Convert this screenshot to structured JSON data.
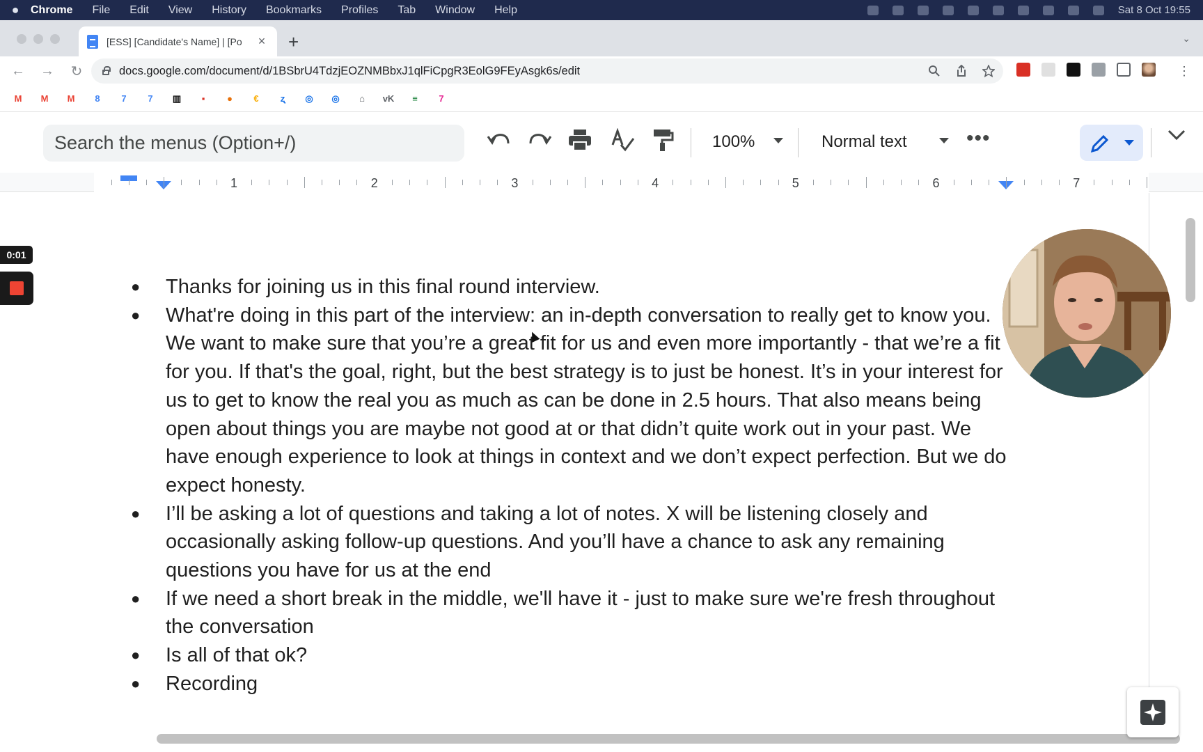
{
  "macos_menubar": {
    "app_name": "Chrome",
    "menus": [
      "File",
      "Edit",
      "View",
      "History",
      "Bookmarks",
      "Profiles",
      "Tab",
      "Window",
      "Help"
    ],
    "clock": "Sat 8 Oct  19:55"
  },
  "browser": {
    "tab": {
      "title": "[ESS] [Candidate's Name] | [Po",
      "close_glyph": "×"
    },
    "new_tab_glyph": "+",
    "tab_menu_glyph": "⌄",
    "address_bar": {
      "url": "docs.google.com/document/d/1BSbrU4TdzjEOZNMBbxJ1qlFiCpgR3EolG9FEyAsgk6s/edit"
    },
    "nav": {
      "back": "←",
      "forward": "→",
      "reload": "↻"
    }
  },
  "bookmarks": [
    {
      "icon": "gmail-icon",
      "glyph": "M",
      "color": "#ea4335"
    },
    {
      "icon": "gmail-icon",
      "glyph": "M",
      "color": "#ea4335"
    },
    {
      "icon": "gmail-icon",
      "glyph": "M",
      "color": "#ea4335"
    },
    {
      "icon": "calendar-icon",
      "glyph": "8",
      "color": "#4285f4"
    },
    {
      "icon": "calendar-icon",
      "glyph": "7",
      "color": "#4285f4"
    },
    {
      "icon": "calendar-icon",
      "glyph": "7",
      "color": "#4285f4"
    },
    {
      "icon": "trello-icon",
      "glyph": "▥",
      "color": "#111111"
    },
    {
      "icon": "app-icon",
      "glyph": "▪",
      "color": "#d93025"
    },
    {
      "icon": "app-icon",
      "glyph": "●",
      "color": "#e8710a"
    },
    {
      "icon": "euro-icon",
      "glyph": "€",
      "color": "#f9ab00"
    },
    {
      "icon": "app-icon",
      "glyph": "ʐ",
      "color": "#1a73e8"
    },
    {
      "icon": "chat-icon",
      "glyph": "◎",
      "color": "#1a73e8"
    },
    {
      "icon": "chat-icon",
      "glyph": "◎",
      "color": "#1a73e8"
    },
    {
      "icon": "app-icon",
      "glyph": "⌂",
      "color": "#5f6368"
    },
    {
      "icon": "vk-icon",
      "glyph": "vK",
      "color": "#5f6368"
    },
    {
      "icon": "list-icon",
      "glyph": "≡",
      "color": "#188038"
    },
    {
      "icon": "app-icon",
      "glyph": "7",
      "color": "#e52592"
    }
  ],
  "docs_toolbar": {
    "menu_search_placeholder": "Search the menus (Option+/)",
    "zoom": "100%",
    "paragraph_style": "Normal text",
    "more_glyph": "•••"
  },
  "ruler": {
    "numbers": [
      "1",
      "2",
      "3",
      "4",
      "5",
      "6",
      "7"
    ]
  },
  "recording": {
    "timer": "0:01"
  },
  "document": {
    "bullets": [
      "Thanks for joining us in this final round interview.",
      "What're doing in this part of the interview: an in-depth conversation to really get to know you. We want to make sure that you’re a great fit for us and even more importantly - that we’re a fit for you. If that's the goal, right, but the best strategy is to just be honest. It’s in your interest for us to get to know the real you as much as can be done in 2.5 hours. That also means being open about things you are maybe not good at or that didn’t quite work out in your past. We have enough experience to look at things in context and we don’t expect perfection. But we do expect honesty.",
      "I’ll be asking a lot of questions and taking a lot of notes. X will be listening closely and occasionally asking follow-up questions. And you’ll have a chance to ask any remaining questions you have for us at the end",
      "If we need a short break in the middle, we'll have it - just to make sure we're fresh throughout the conversation",
      "Is all of that ok?",
      "Recording"
    ]
  }
}
